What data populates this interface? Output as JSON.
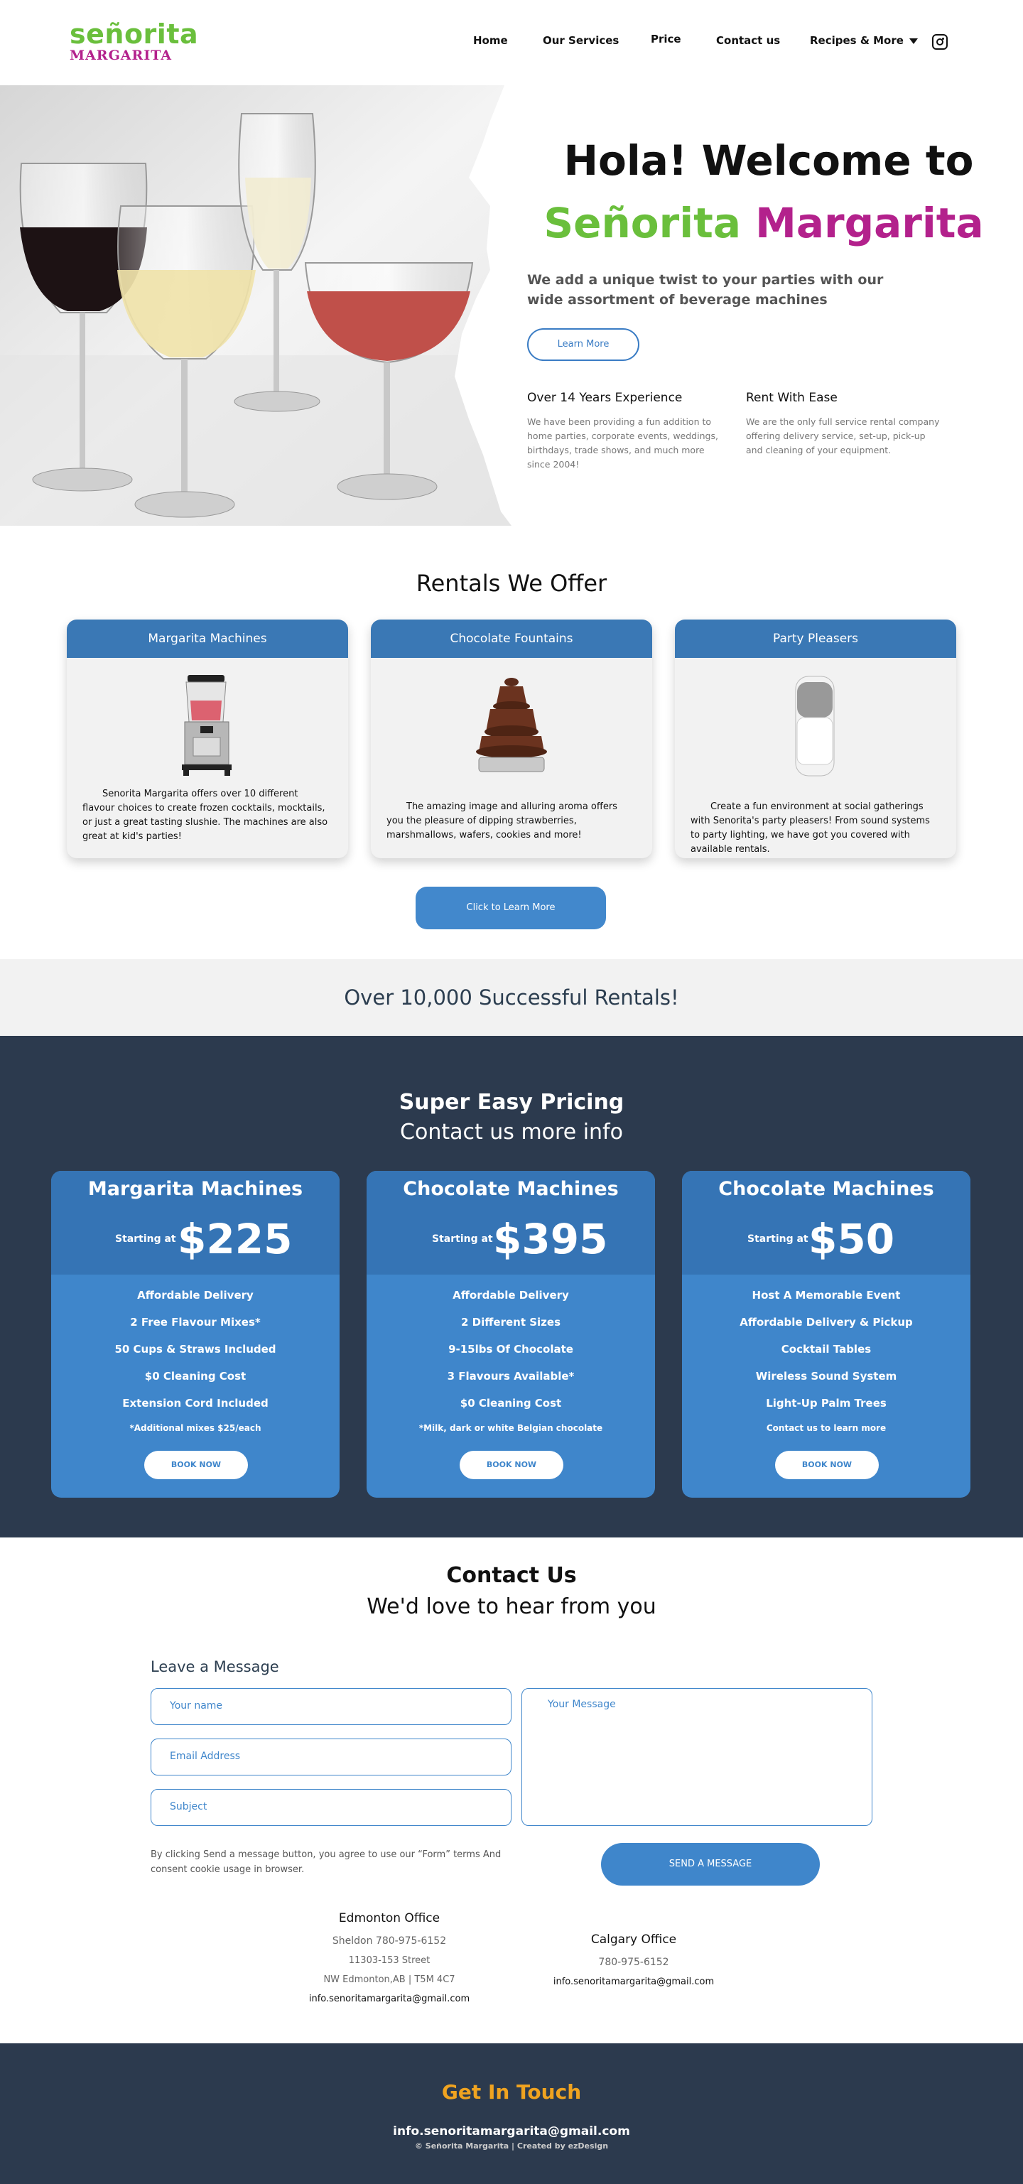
{
  "colors": {
    "green": "#6abf3c",
    "magenta": "#b3218c",
    "blue": "#3f86cb",
    "navy": "#2c3a4e",
    "orange": "#f0a320"
  },
  "logo": {
    "top": "señorita",
    "bottom": "MARGARITA"
  },
  "nav": {
    "items": [
      "Home",
      "Our Services",
      "Price",
      "Contact us",
      "Recipes & More"
    ],
    "instagram_icon": "instagram-icon"
  },
  "hero": {
    "title_line1": "Hola! Welcome to",
    "title_green": "Señorita",
    "title_magenta": "Margarita",
    "subtitle": "We add a unique twist to your parties with our wide assortment of beverage machines",
    "button": "Learn More",
    "features": [
      {
        "title": "Over 14 Years Experience",
        "text": "We have been providing a fun addition to home parties, corporate events, weddings, birthdays, trade shows, and much more since 2004!"
      },
      {
        "title": "Rent With Ease",
        "text": "We are the only full service rental company offering delivery service, set-up, pick-up and cleaning of your equipment."
      }
    ]
  },
  "rentals": {
    "title": "Rentals We Offer",
    "cards": [
      {
        "title": "Margarita Machines",
        "text": "Senorita Margarita offers over 10 different flavour choices to create frozen cocktails, mocktails, or just a great tasting slushie. The machines are also great at kid's parties!"
      },
      {
        "title": "Chocolate Fountains",
        "text": "The amazing image and alluring aroma offers you the pleasure of dipping strawberries, marshmallows, wafers, cookies and more!"
      },
      {
        "title": "Party Pleasers",
        "text": "Create a fun environment at social gatherings with Senorita's party pleasers! From sound systems to party lighting, we have got you covered with available rentals."
      }
    ],
    "cta": "Click to Learn More"
  },
  "stat": "Over 10,000 Successful Rentals!",
  "pricing": {
    "title": "Super Easy Pricing",
    "subtitle": "Contact us more info",
    "cards": [
      {
        "name": "Margarita Machines",
        "starting": "Starting at",
        "price": "$225",
        "features": [
          "Affordable Delivery",
          "2 Free Flavour Mixes*",
          "50 Cups & Straws Included",
          "$0 Cleaning Cost",
          "Extension Cord Included"
        ],
        "note": "*Additional mixes $25/each",
        "button": "BOOK NOW"
      },
      {
        "name": "Chocolate Machines",
        "starting": "Starting at",
        "price": "$395",
        "features": [
          "Affordable Delivery",
          "2 Different Sizes",
          "9-15lbs Of Chocolate",
          "3 Flavours Available*",
          "$0 Cleaning Cost"
        ],
        "note": "*Milk, dark or white Belgian chocolate",
        "button": "BOOK NOW"
      },
      {
        "name": "Chocolate Machines",
        "starting": "Starting at",
        "price": "$50",
        "features": [
          "Host A Memorable Event",
          "Affordable Delivery & Pickup",
          "Cocktail Tables",
          "Wireless Sound System",
          "Light-Up Palm Trees"
        ],
        "note": "Contact us to learn more",
        "button": "BOOK NOW"
      }
    ]
  },
  "contact": {
    "title": "Contact Us",
    "subtitle": "We'd love to hear from you",
    "form_title": "Leave a Message",
    "name_placeholder": "Your name",
    "email_placeholder": "Email Address",
    "subject_placeholder": "Subject",
    "message_placeholder": "Your Message",
    "consent": "By clicking Send a message button, you agree to use our “Form” terms And consent cookie usage in browser.",
    "send": "SEND A MESSAGE",
    "offices": [
      {
        "name": "Edmonton Office",
        "line1": "Sheldon 780-975-6152",
        "line2": "11303-153 Street",
        "line3": "NW Edmonton,AB | T5M 4C7",
        "email": "info.senoritamargarita@gmail.com"
      },
      {
        "name": "Calgary Office",
        "line1": "780-975-6152",
        "email": "info.senoritamargarita@gmail.com"
      }
    ]
  },
  "footer": {
    "title": "Get In Touch",
    "email": "info.senoritamargarita@gmail.com",
    "copyright": "© Señorita Margarita | Created by ezDesign"
  }
}
